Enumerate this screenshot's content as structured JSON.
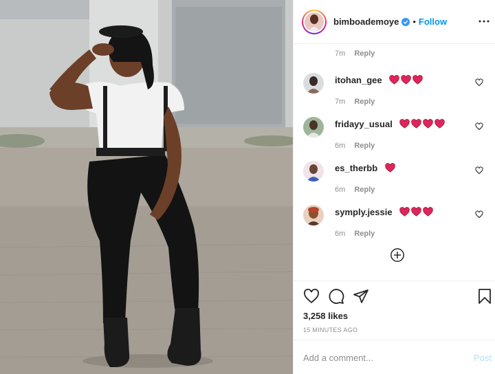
{
  "post": {
    "username": "bimboademoye",
    "follow_label": "Follow",
    "dot": "•"
  },
  "first_meta": {
    "time": "7m",
    "reply_label": "Reply"
  },
  "comments": [
    {
      "username": "itohan_gee",
      "hearts": 3,
      "time": "7m",
      "reply_label": "Reply"
    },
    {
      "username": "fridayy_usual",
      "hearts": 4,
      "time": "6m",
      "reply_label": "Reply"
    },
    {
      "username": "es_therbb",
      "hearts": 1,
      "time": "6m",
      "reply_label": "Reply"
    },
    {
      "username": "symply.jessie",
      "hearts": 3,
      "time": "6m",
      "reply_label": "Reply"
    }
  ],
  "likes_text": "3,258 likes",
  "time_ago": "15 MINUTES AGO",
  "add_comment": {
    "placeholder": "Add a comment...",
    "post_label": "Post"
  },
  "icons": {
    "verified": "verified-badge-icon",
    "more": "more-options-icon",
    "like": "heart-icon",
    "comment": "comment-icon",
    "share": "share-icon",
    "save": "bookmark-icon",
    "load_more": "plus-circle-icon"
  },
  "colors": {
    "accent": "#0095f6",
    "heart_emoji": "#e0245e",
    "muted": "#8e8e8e"
  }
}
